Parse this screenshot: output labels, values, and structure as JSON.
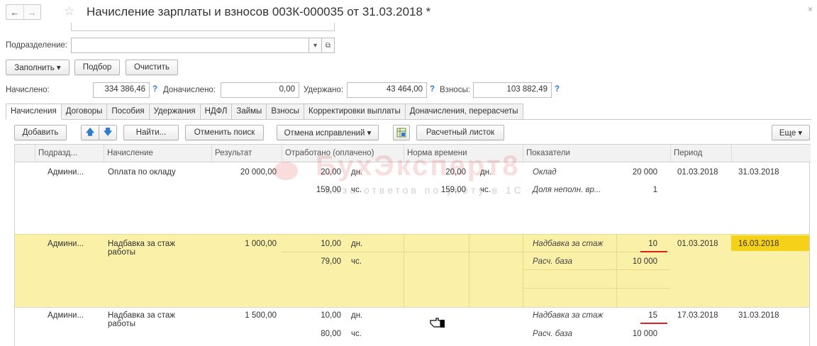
{
  "window": {
    "title": "Начисление зарплаты и взносов 003К-000035 от 31.03.2018 *",
    "back_glyph": "←",
    "forward_glyph": "→",
    "star_glyph": "☆",
    "close_glyph": "×"
  },
  "form": {
    "subdivision_label": "Подразделение:",
    "subdivision_value": "",
    "dropdown_glyph": "▾",
    "open_glyph": "⧉"
  },
  "actions": {
    "fill": "Заполнить ▾",
    "pick": "Подбор",
    "clear": "Очистить"
  },
  "totals": {
    "accrued_label": "Начислено:",
    "accrued_value": "334 386,46",
    "additional_label": "Доначислено:",
    "additional_value": "0,00",
    "withheld_label": "Удержано:",
    "withheld_value": "43 464,00",
    "contributions_label": "Взносы:",
    "contributions_value": "103 882,49",
    "help_glyph": "?"
  },
  "tabs": [
    "Начисления",
    "Договоры",
    "Пособия",
    "Удержания",
    "НДФЛ",
    "Займы",
    "Взносы",
    "Корректировки выплаты",
    "Доначисления, перерасчеты"
  ],
  "toolbar": {
    "add": "Добавить",
    "up_glyph": "🡅",
    "down_glyph": "🡇",
    "find": "Найти...",
    "cancel_search": "Отменить поиск",
    "cancel_corrections": "Отмена исправлений ▾",
    "payslip": "Расчетный листок",
    "more": "Еще ▾"
  },
  "table": {
    "headers": {
      "subdivision": "Подразд...",
      "accrual": "Начисление",
      "result": "Результат",
      "worked": "Отработано (оплачено)",
      "norm": "Норма времени",
      "indicators": "Показатели",
      "period": "Период"
    },
    "rows": [
      {
        "subdivision": "Админи...",
        "accrual": "Оплата по окладу",
        "accrual2": "",
        "result": "20 000,00",
        "worked1": "20,00",
        "unit1": "дн.",
        "worked2": "159,00",
        "unit2": "чс.",
        "norm1": "20,00",
        "norm_unit1": "дн.",
        "norm2": "159,00",
        "norm_unit2": "чс.",
        "ind1_name": "Оклад",
        "ind1_value": "20 000",
        "ind2_name": "Доля неполн. вр...",
        "ind2_value": "1",
        "period_start": "01.03.2018",
        "period_end": "31.03.2018"
      },
      {
        "subdivision": "Админи...",
        "accrual": "Надбавка за стаж",
        "accrual2": "работы",
        "result": "1 000,00",
        "worked1": "10,00",
        "unit1": "дн.",
        "worked2": "79,00",
        "unit2": "чс.",
        "ind1_name": "Надбавка за стаж",
        "ind1_value": "10",
        "ind2_name": "Расч. база",
        "ind2_value": "10 000",
        "period_start": "01.03.2018",
        "period_end": "16.03.2018"
      },
      {
        "subdivision": "Админи...",
        "accrual": "Надбавка за стаж",
        "accrual2": "работы",
        "result": "1 500,00",
        "worked1": "10,00",
        "unit1": "дн.",
        "worked2": "80,00",
        "unit2": "чс.",
        "ind1_name": "Надбавка за стаж",
        "ind1_value": "15",
        "ind2_name": "Расч. база",
        "ind2_value": "10 000",
        "period_start": "17.03.2018",
        "period_end": "31.03.2018"
      }
    ]
  },
  "watermark": {
    "brand": "БухЭксперт8",
    "tagline": "База ответов по учёту в 1С"
  },
  "colors": {
    "selected_row": "#faf0a8",
    "highlight_cell": "#f5d11a",
    "underline": "#e02020",
    "help": "#2e7bcf"
  }
}
